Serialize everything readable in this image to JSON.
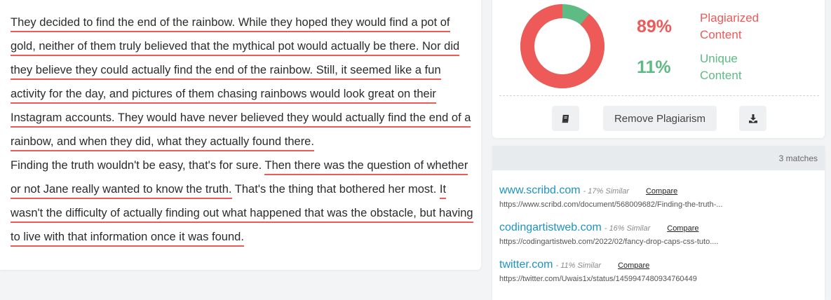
{
  "text": {
    "segments": [
      {
        "t": "They decided to find the end of the rainbow. While they hoped they would find a pot of gold, neither of them truly believed that the mythical pot would actually be there. Nor did they believe they could actually find the end of the rainbow. Still, it seemed like a fun activity for the day, and pictures of them chasing rainbows would look great on their Instagram accounts. They would have never believed they would actually find the end of a rainbow, and when they did, what they actually found there.",
        "highlight": true
      },
      {
        "t": "Finding the truth wouldn't be easy, that's for sure. ",
        "highlight": false,
        "newline": true
      },
      {
        "t": "Then there was the question of whether or not Jane really wanted to know the truth.",
        "highlight": true
      },
      {
        "t": " That's the thing that bothered her most. ",
        "highlight": false
      },
      {
        "t": "It wasn't the difficulty of actually finding out what happened that was the obstacle, but having to live with that information once it was found.",
        "highlight": true
      }
    ]
  },
  "result": {
    "plagiarized_pct": "89%",
    "plagiarized_label": "Plagiarized Content",
    "unique_pct": "11%",
    "unique_label": "Unique Content",
    "plagiarized_fraction": 0.89,
    "colors": {
      "plagiarized": "#ee5a57",
      "unique": "#5dbb83",
      "highlight": "#ee5a57",
      "link": "#1d93c2"
    },
    "buttons": {
      "book_icon": "book-icon",
      "remove_label": "Remove Plagiarism",
      "download_icon": "download-icon"
    }
  },
  "matches": {
    "count_label": "3 matches",
    "items": [
      {
        "domain": "www.scribd.com",
        "similar": "- 17% Similar",
        "compare": "Compare",
        "url": "https://www.scribd.com/document/568009682/Finding-the-truth-..."
      },
      {
        "domain": "codingartistweb.com",
        "similar": "- 16% Similar",
        "compare": "Compare",
        "url": "https://codingartistweb.com/2022/02/fancy-drop-caps-css-tuto...."
      },
      {
        "domain": "twitter.com",
        "similar": "- 11% Similar",
        "compare": "Compare",
        "url": "https://twitter.com/Uwais1x/status/1459947480934760449"
      }
    ]
  }
}
